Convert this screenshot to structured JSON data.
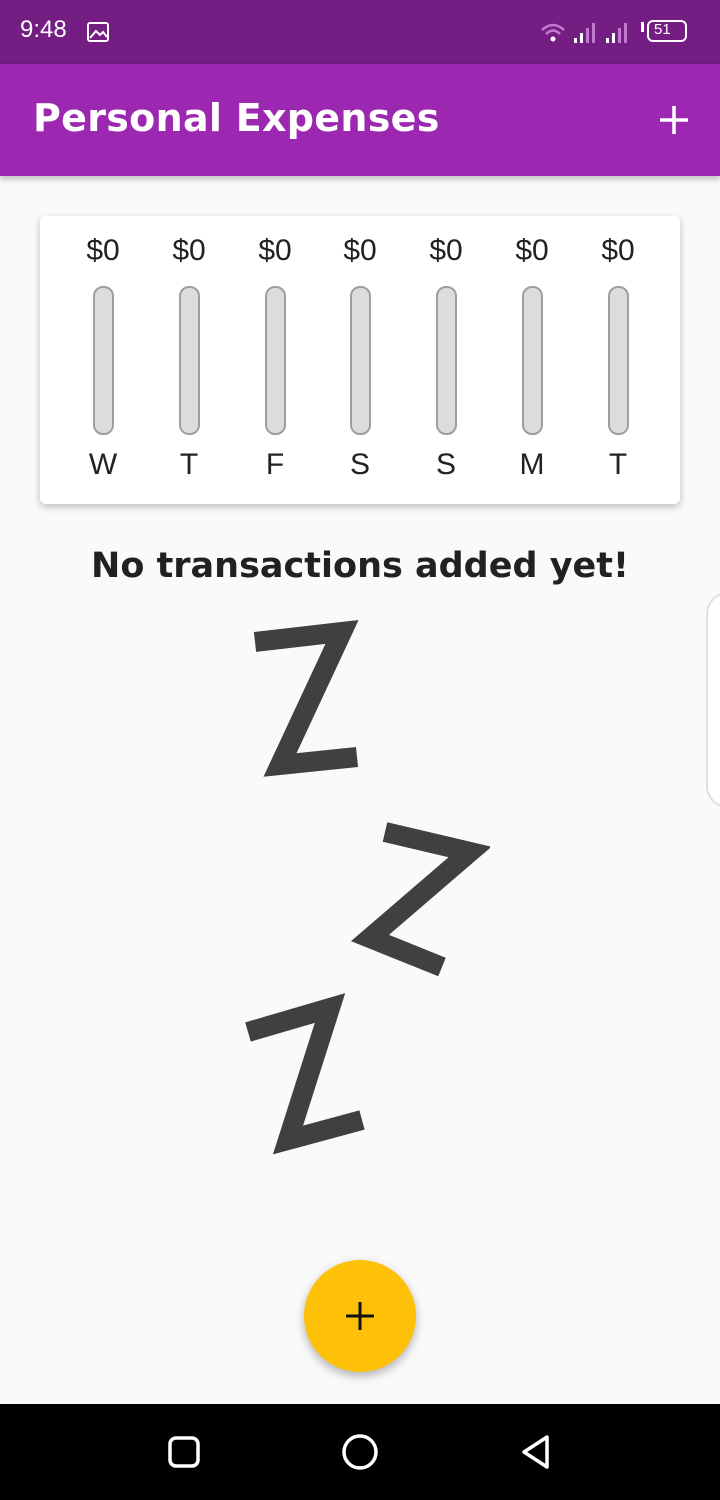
{
  "status_bar": {
    "time": "9:48",
    "battery": "51",
    "icons": [
      "gallery-icon",
      "wifi-icon",
      "signal-icon",
      "signal-icon",
      "battery-icon"
    ]
  },
  "app_bar": {
    "title": "Personal Expenses",
    "action_icon": "add-icon",
    "color": "#9c27b0"
  },
  "chart": {
    "bars": [
      {
        "amount": "$0",
        "day": "W",
        "fraction": 0
      },
      {
        "amount": "$0",
        "day": "T",
        "fraction": 0
      },
      {
        "amount": "$0",
        "day": "F",
        "fraction": 0
      },
      {
        "amount": "$0",
        "day": "S",
        "fraction": 0
      },
      {
        "amount": "$0",
        "day": "S",
        "fraction": 0
      },
      {
        "amount": "$0",
        "day": "M",
        "fraction": 0
      },
      {
        "amount": "$0",
        "day": "T",
        "fraction": 0
      }
    ]
  },
  "empty_state": {
    "message": "No transactions added yet!",
    "image_icon": "sleeping-zzz-image"
  },
  "fab": {
    "icon": "add-icon",
    "color": "#ffc107"
  },
  "nav_bar": {
    "icons": [
      "recent-apps-icon",
      "home-icon",
      "back-icon"
    ]
  }
}
